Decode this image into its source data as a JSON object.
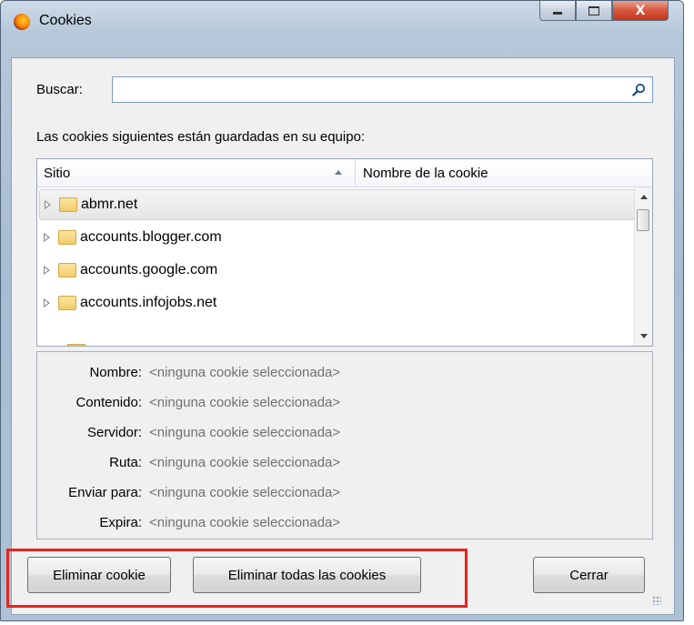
{
  "window": {
    "title": "Cookies",
    "controls": [
      "minimize",
      "maximize",
      "close"
    ],
    "close_glyph": "X"
  },
  "search": {
    "label": "Buscar:",
    "value": "",
    "placeholder": "",
    "icon": "search-icon"
  },
  "info_text": "Las cookies siguientes están guardadas en su equipo:",
  "tree": {
    "columns": [
      {
        "label": "Sitio",
        "sort": "ascending"
      },
      {
        "label": "Nombre de la cookie"
      }
    ],
    "rows": [
      {
        "label": "abmr.net",
        "selected": true,
        "icon": "folder-icon",
        "expandable": true
      },
      {
        "label": "accounts.blogger.com",
        "selected": false,
        "icon": "folder-icon",
        "expandable": true
      },
      {
        "label": "accounts.google.com",
        "selected": false,
        "icon": "folder-icon",
        "expandable": true
      },
      {
        "label": "accounts.infojobs.net",
        "selected": false,
        "icon": "folder-icon",
        "expandable": true
      }
    ]
  },
  "details": [
    {
      "label": "Nombre:",
      "value": "<ninguna cookie seleccionada>"
    },
    {
      "label": "Contenido:",
      "value": "<ninguna cookie seleccionada>"
    },
    {
      "label": "Servidor:",
      "value": "<ninguna cookie seleccionada>"
    },
    {
      "label": "Ruta:",
      "value": "<ninguna cookie seleccionada>"
    },
    {
      "label": "Enviar para:",
      "value": "<ninguna cookie seleccionada>"
    },
    {
      "label": "Expira:",
      "value": "<ninguna cookie seleccionada>"
    }
  ],
  "buttons": {
    "remove": "Eliminar cookie",
    "remove_all": "Eliminar todas las cookies",
    "close": "Cerrar"
  },
  "colors": {
    "highlight": "#e8231c",
    "detail_value": "#707070"
  }
}
